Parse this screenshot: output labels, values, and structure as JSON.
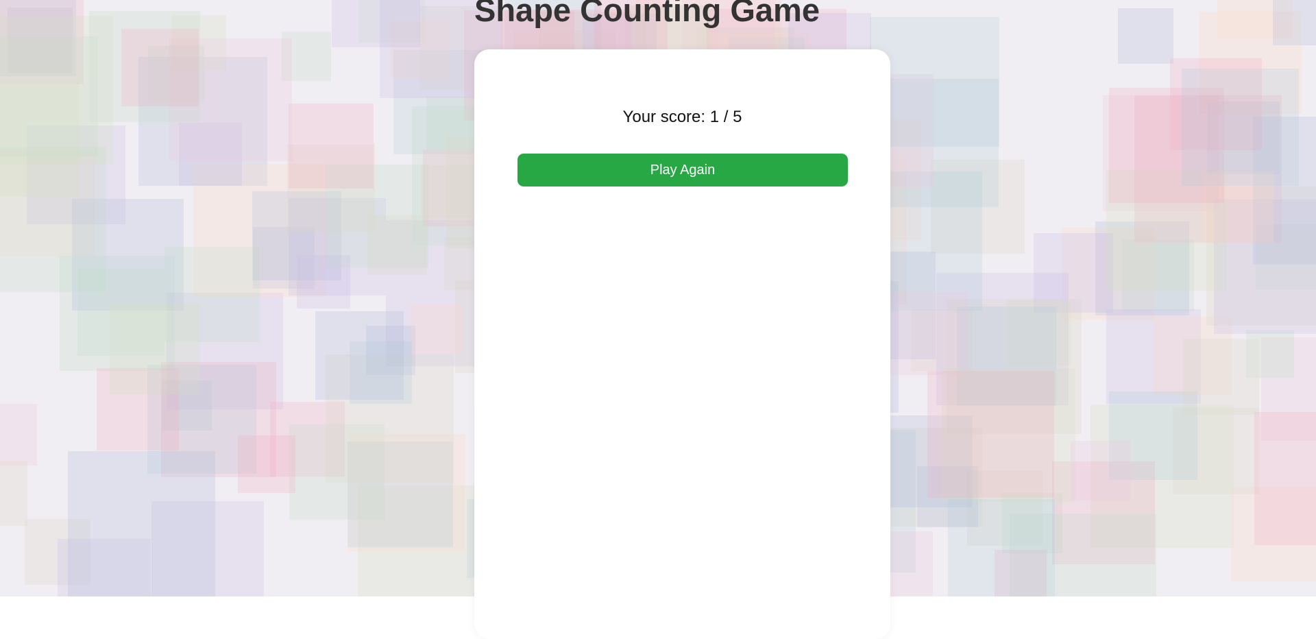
{
  "game": {
    "title": "Shape Counting Game",
    "score_text": "Your score: 1 / 5",
    "score": 1,
    "total": 5,
    "play_again_label": "Play Again"
  },
  "colors": {
    "button": "#28a745",
    "title": "#333333",
    "card": "#ffffff"
  }
}
